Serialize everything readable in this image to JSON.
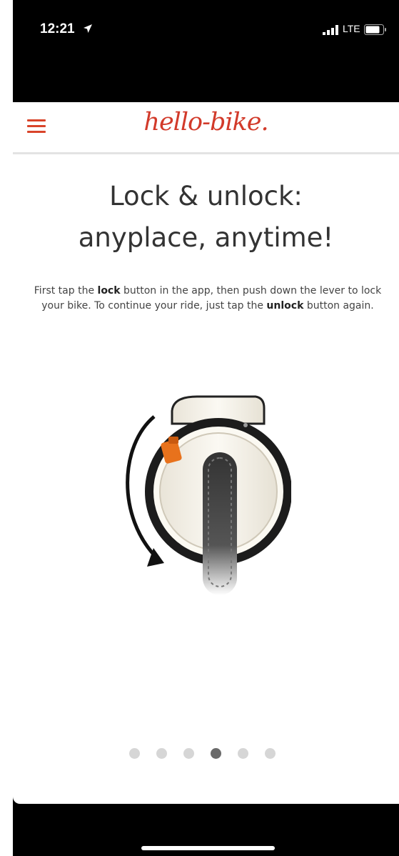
{
  "status_bar": {
    "time": "12:21",
    "carrier": "LTE",
    "icons": [
      "location-arrow-icon",
      "signal-icon",
      "battery-icon"
    ]
  },
  "navbar": {
    "logo_text": "hello-bike.",
    "menu_icon": "hamburger-menu-icon",
    "brand_color": "#d23a2a"
  },
  "slide": {
    "title_line1": "Lock & unlock:",
    "title_line2": "anyplace, anytime!",
    "desc_part1": "First tap the ",
    "desc_bold1": "lock",
    "desc_part2": " button in the app, then push down the lever to lock your bike. To continue your ride, just tap the ",
    "desc_bold2": "unlock",
    "desc_part3": " button again.",
    "image": "bike-ring-lock-illustration"
  },
  "pagination": {
    "total": 6,
    "active_index": 3
  }
}
